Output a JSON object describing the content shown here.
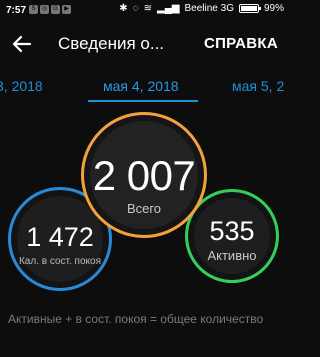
{
  "status_bar": {
    "time": "7:57",
    "apps": [
      "S",
      "◎",
      "G",
      "▶"
    ],
    "carrier": "Beeline 3G",
    "battery": "99%",
    "icons": [
      "bluetooth-icon",
      "mute-icon",
      "wifi-icon",
      "signal-icon"
    ]
  },
  "toolbar": {
    "back_icon": "arrow-left-icon",
    "title": "Сведения о...",
    "action": "СПРАВКА"
  },
  "dates": {
    "prev": "3, 2018",
    "current": "мая 4, 2018",
    "next": "мая 5, 2"
  },
  "stats": {
    "total": {
      "value": "2 007",
      "label": "Всего",
      "color": "#f2a13b"
    },
    "rest": {
      "value": "1 472",
      "label": "Кал. в сост. покоя",
      "color": "#2b8ad6"
    },
    "active": {
      "value": "535",
      "label": "Активно",
      "color": "#34d05a"
    }
  },
  "caption": "Активные + в сост. покоя = общее количество"
}
